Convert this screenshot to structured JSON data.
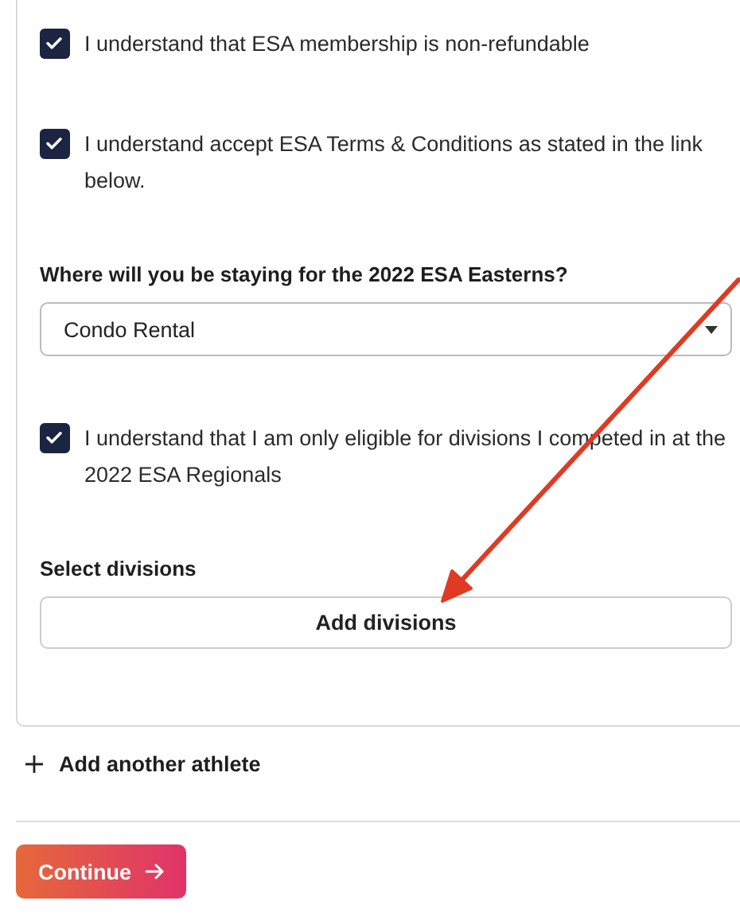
{
  "form": {
    "items": [
      {
        "kind": "checkbox",
        "label": "I understand that ESA membership is non-refundable",
        "checked": true
      },
      {
        "kind": "checkbox",
        "label": "I understand accept ESA Terms & Conditions as stated in the link below.",
        "checked": true
      },
      {
        "kind": "select",
        "label": "Where will you be staying for the 2022 ESA Easterns?",
        "value": "Condo Rental"
      },
      {
        "kind": "checkbox",
        "label": "I understand that I am only eligible for divisions I competed in at the 2022 ESA Regionals",
        "checked": true
      },
      {
        "kind": "button",
        "label": "Select divisions",
        "button": "Add divisions"
      }
    ]
  },
  "add_athlete": {
    "label": "Add another athlete"
  },
  "continue_button": {
    "label": "Continue"
  }
}
